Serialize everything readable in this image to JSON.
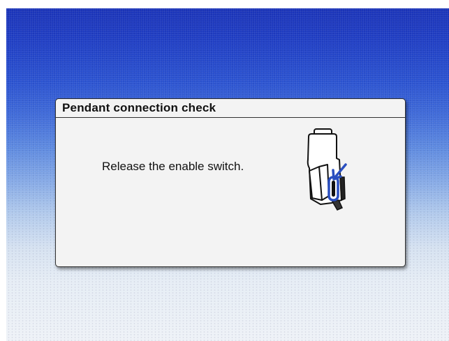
{
  "dialog": {
    "title": "Pendant connection check",
    "message": "Release the enable switch.",
    "illustration_icon": "teach-pendant-enable-switch-icon"
  },
  "colors": {
    "background_top": "#1a33b8",
    "background_bottom": "#eef2f7",
    "dialog_background": "#f3f3f3",
    "highlight": "#2a4fc0"
  }
}
